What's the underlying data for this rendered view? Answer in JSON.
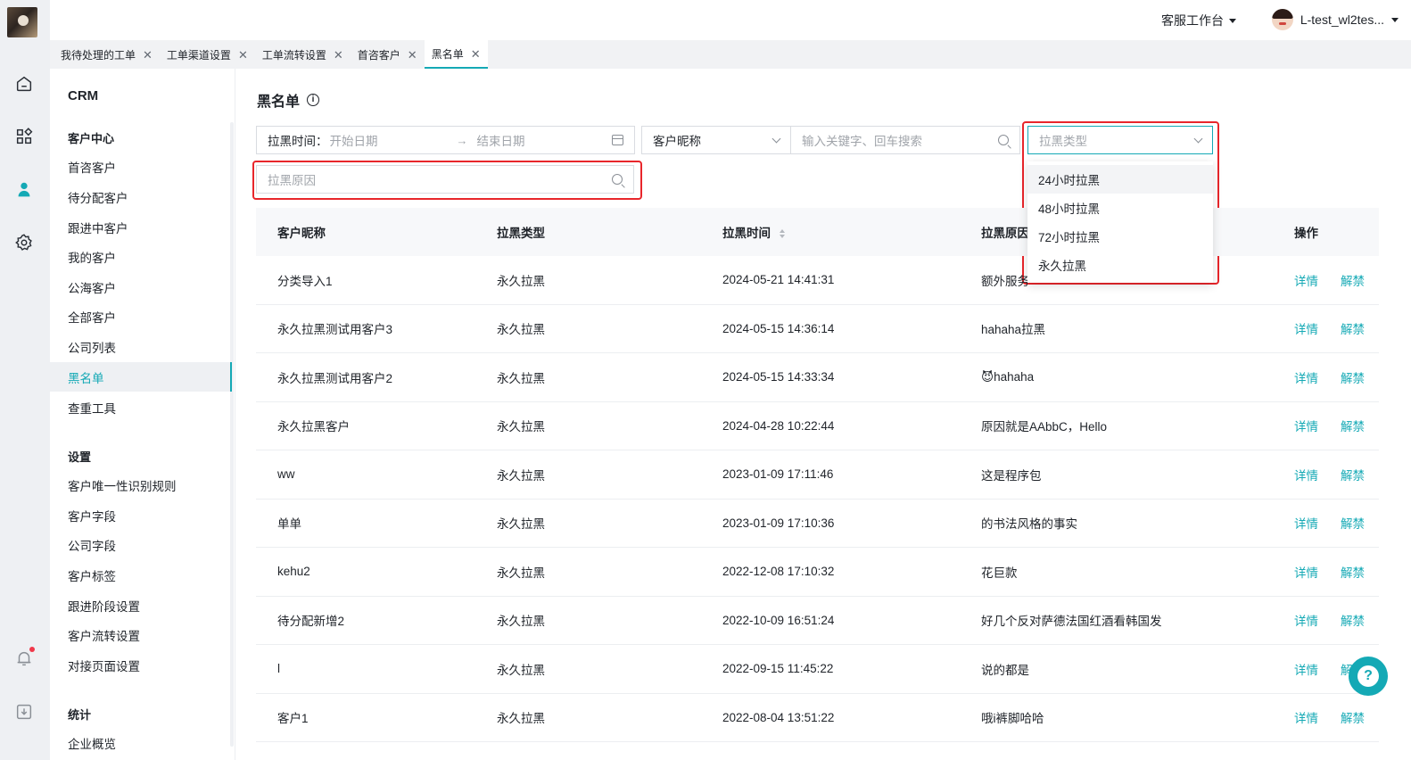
{
  "topbar": {
    "workbench_label": "客服工作台",
    "user_name": "L-test_wl2tes..."
  },
  "tabs": [
    {
      "label": "我待处理的工单",
      "active": false
    },
    {
      "label": "工单渠道设置",
      "active": false
    },
    {
      "label": "工单流转设置",
      "active": false
    },
    {
      "label": "首咨客户",
      "active": false
    },
    {
      "label": "黑名单",
      "active": true
    }
  ],
  "subnav": {
    "title": "CRM",
    "groups": [
      {
        "label": "客户中心",
        "items": [
          "首咨客户",
          "待分配客户",
          "跟进中客户",
          "我的客户",
          "公海客户",
          "全部客户",
          "公司列表",
          "黑名单",
          "查重工具"
        ]
      },
      {
        "label": "设置",
        "items": [
          "客户唯一性识别规则",
          "客户字段",
          "公司字段",
          "客户标签",
          "跟进阶段设置",
          "客户流转设置",
          "对接页面设置"
        ]
      },
      {
        "label": "统计",
        "items": [
          "企业概览"
        ]
      }
    ],
    "active_item": "黑名单"
  },
  "page": {
    "title": "黑名单"
  },
  "filters": {
    "date_label": "拉黑时间：",
    "start_placeholder": "开始日期",
    "end_placeholder": "结束日期",
    "nickname_select": "客户昵称",
    "keyword_placeholder": "输入关键字、回车搜索",
    "type_placeholder": "拉黑类型",
    "reason_placeholder": "拉黑原因"
  },
  "type_dropdown": {
    "options": [
      "24小时拉黑",
      "48小时拉黑",
      "72小时拉黑",
      "永久拉黑"
    ],
    "hovered": "24小时拉黑"
  },
  "table": {
    "headers": [
      "客户昵称",
      "拉黑类型",
      "拉黑时间",
      "拉黑原因",
      "操作"
    ],
    "action_detail": "详情",
    "action_unblock": "解禁",
    "rows": [
      {
        "name": "分类导入1",
        "type": "永久拉黑",
        "time": "2024-05-21 14:41:31",
        "reason": "额外服务"
      },
      {
        "name": "永久拉黑测试用客户3",
        "type": "永久拉黑",
        "time": "2024-05-15 14:36:14",
        "reason": "hahaha拉黑"
      },
      {
        "name": "永久拉黑测试用客户2",
        "type": "永久拉黑",
        "time": "2024-05-15 14:33:34",
        "reason": "😈hahaha"
      },
      {
        "name": "永久拉黑客户",
        "type": "永久拉黑",
        "time": "2024-04-28 10:22:44",
        "reason": "原因就是AAbbC，Hello"
      },
      {
        "name": "ww",
        "type": "永久拉黑",
        "time": "2023-01-09 17:11:46",
        "reason": "这是程序包"
      },
      {
        "name": "单单",
        "type": "永久拉黑",
        "time": "2023-01-09 17:10:36",
        "reason": "的书法风格的事实"
      },
      {
        "name": "kehu2",
        "type": "永久拉黑",
        "time": "2022-12-08 17:10:32",
        "reason": "花巨款"
      },
      {
        "name": "待分配新增2",
        "type": "永久拉黑",
        "time": "2022-10-09 16:51:24",
        "reason": "好几个反对萨德法国红酒看韩国发"
      },
      {
        "name": "l",
        "type": "永久拉黑",
        "time": "2022-09-15 11:45:22",
        "reason": "说的都是"
      },
      {
        "name": "客户1",
        "type": "永久拉黑",
        "time": "2022-08-04 13:51:22",
        "reason": "哦i裤脚哈哈"
      }
    ]
  },
  "help": {
    "label": "?"
  },
  "colors": {
    "accent": "#14a9b5",
    "highlight": "#e8262b"
  }
}
